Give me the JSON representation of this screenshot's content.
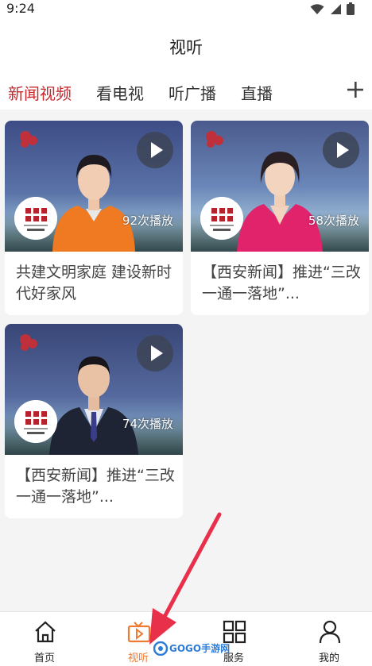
{
  "status": {
    "time": "9:24"
  },
  "header": {
    "title": "视听"
  },
  "tabs": [
    {
      "label": "新闻视频"
    },
    {
      "label": "看电视"
    },
    {
      "label": "听广播"
    },
    {
      "label": "直播"
    }
  ],
  "videos": [
    {
      "title": "共建文明家庭 建设新时代好家风",
      "plays": "92次播放"
    },
    {
      "title": "【西安新闻】推进“三改一通一落地”...",
      "plays": "58次播放"
    },
    {
      "title": "【西安新闻】推进“三改一通一落地”...",
      "plays": "74次播放"
    }
  ],
  "nav": [
    {
      "label": "首页",
      "icon": "home-icon"
    },
    {
      "label": "视听",
      "icon": "tv-video-icon"
    },
    {
      "label": "服务",
      "icon": "grid-icon"
    },
    {
      "label": "我的",
      "icon": "user-icon"
    }
  ],
  "watermark": {
    "text": "GOGO手游网"
  },
  "colors": {
    "accent": "#c8282d",
    "nav_active": "#ef7a32",
    "arrow": "#e8304a"
  }
}
